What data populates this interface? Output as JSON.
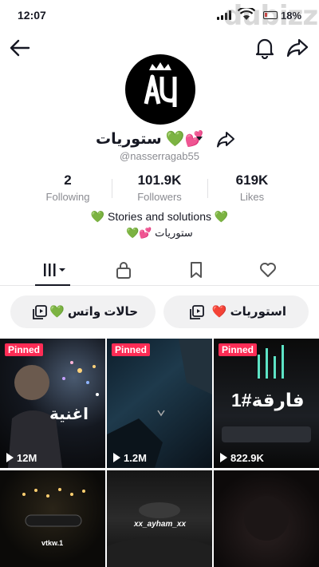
{
  "status": {
    "time": "12:07",
    "battery": "18%",
    "watermark": "dubizzle"
  },
  "profile": {
    "display_name": "💕💚 ستوريات",
    "username": "@nasserragab55",
    "stats": [
      {
        "value": "2",
        "label": "Following"
      },
      {
        "value": "101.9K",
        "label": "Followers"
      },
      {
        "value": "619K",
        "label": "Likes"
      }
    ],
    "bio_line1": "💚 Stories and solutions 💚",
    "bio_line2": "ستوريات 💕💚"
  },
  "collections": [
    {
      "label": "استوريات ❤️"
    },
    {
      "label": "حالات واتس 💚"
    }
  ],
  "videos": [
    {
      "pinned": "Pinned",
      "views": "12M",
      "overlay": "اغنية"
    },
    {
      "pinned": "Pinned",
      "views": "1.2M",
      "overlay": ""
    },
    {
      "pinned": "Pinned",
      "views": "822.9K",
      "overlay": "فارقة#1"
    },
    {
      "pinned": "",
      "views": "",
      "overlay": "vtkw.1"
    },
    {
      "pinned": "",
      "views": "",
      "overlay": "xx_ayham_xx"
    },
    {
      "pinned": "",
      "views": "",
      "overlay": ""
    }
  ],
  "colors": {
    "accent": "#fe2c55",
    "text": "#161823",
    "muted": "#8a8b91",
    "pill_bg": "#f1f1f2"
  }
}
